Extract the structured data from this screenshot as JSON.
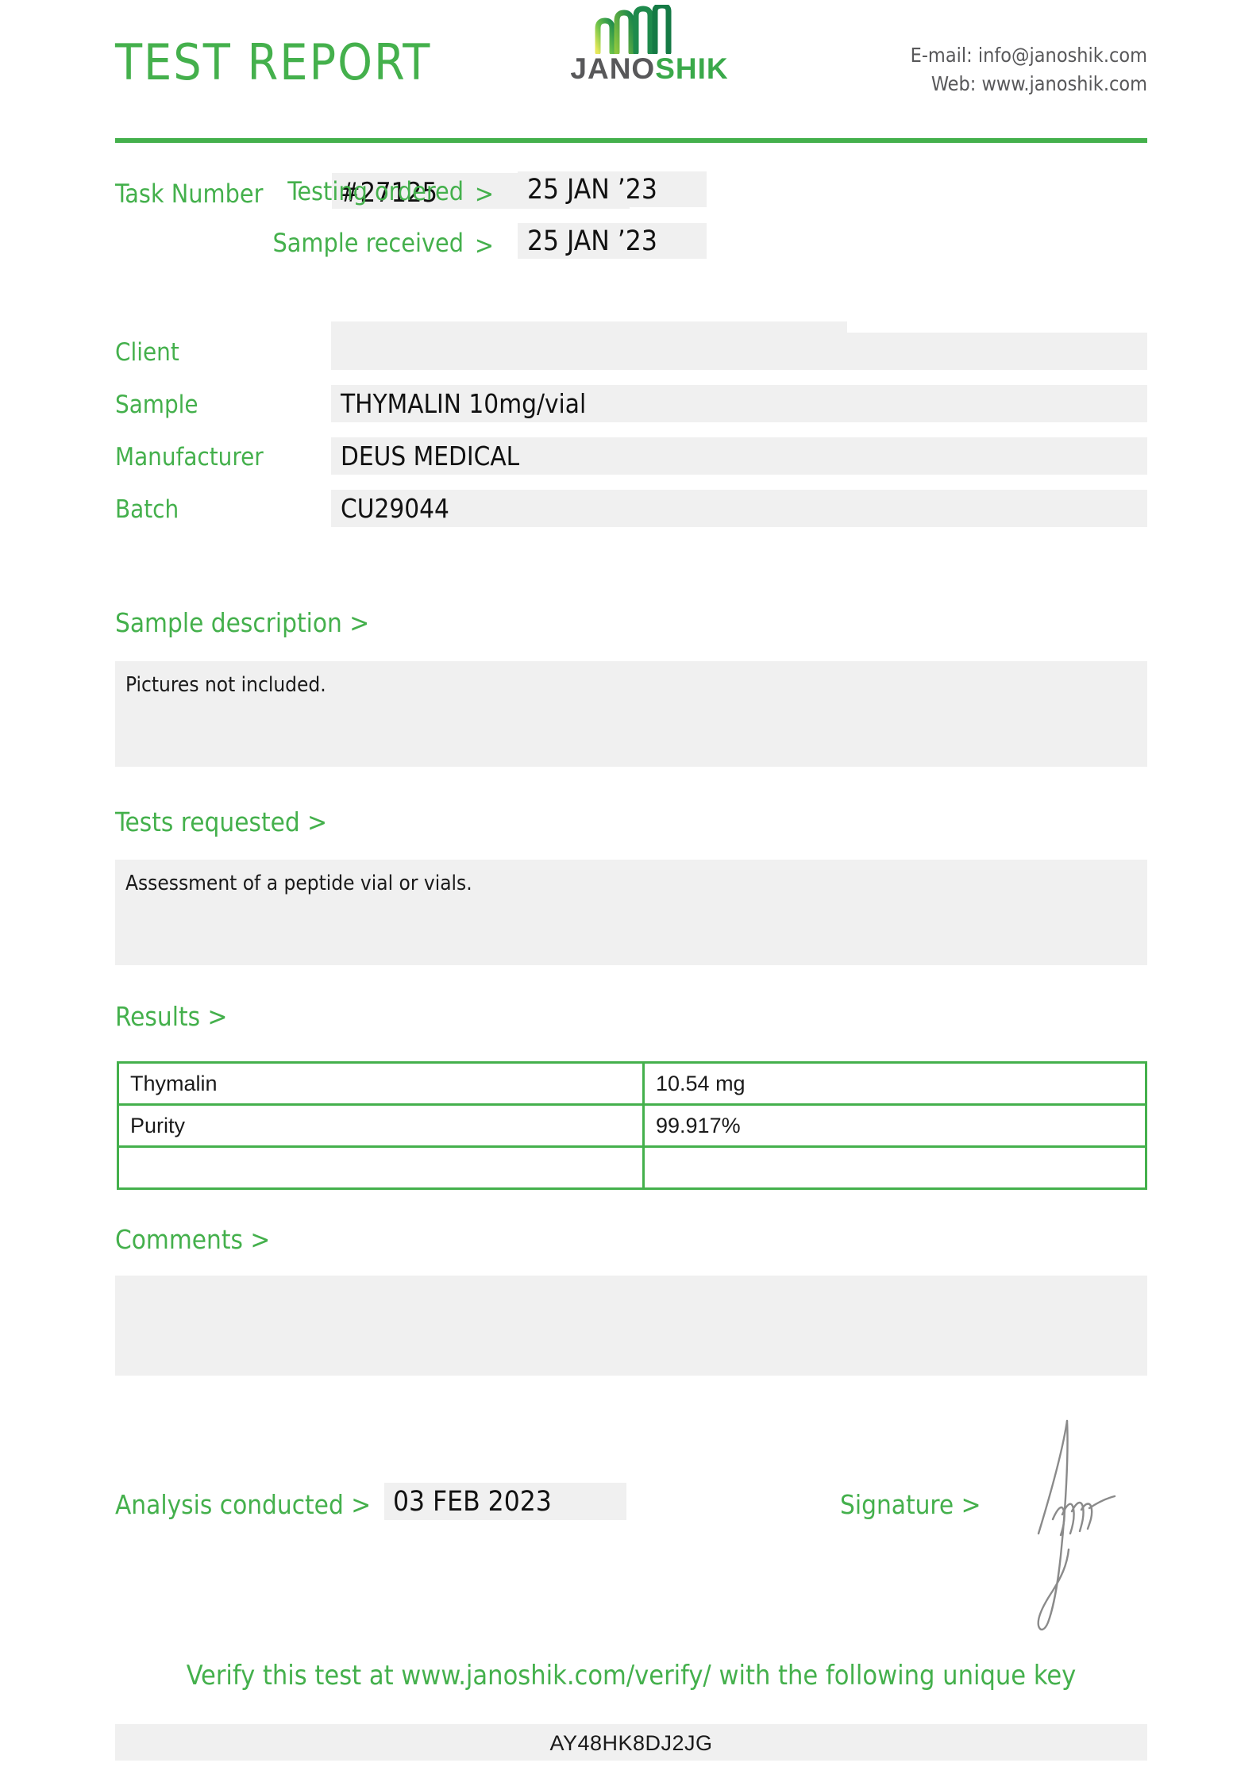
{
  "header": {
    "title": "TEST REPORT",
    "brand_dark": "JANO",
    "brand_green": "SHIK",
    "email_line": "E-mail: info@janoshik.com",
    "web_line": "Web: www.janoshik.com"
  },
  "task": {
    "label": "Task Number",
    "number": "#27125"
  },
  "dates": {
    "testing_ordered_label": "Testing ordered",
    "testing_ordered_value": "25 JAN ’23",
    "sample_received_label": "Sample received",
    "sample_received_value": "25 JAN ’23",
    "separator": ">"
  },
  "info": {
    "client_label": "Client",
    "client_value": "",
    "sample_label": "Sample",
    "sample_value": "THYMALIN 10mg/vial",
    "manufacturer_label": "Manufacturer",
    "manufacturer_value": "DEUS MEDICAL",
    "batch_label": "Batch",
    "batch_value": "CU29044"
  },
  "sample_description": {
    "heading": "Sample description >",
    "text": "Pictures not included."
  },
  "tests_requested": {
    "heading": "Tests requested >",
    "text": "Assessment of a peptide vial or vials."
  },
  "results": {
    "heading": "Results >",
    "rows": [
      {
        "name": "Thymalin",
        "value": "10.54 mg"
      },
      {
        "name": "Purity",
        "value": "99.917%"
      },
      {
        "name": "",
        "value": ""
      }
    ]
  },
  "comments": {
    "heading": "Comments >",
    "text": ""
  },
  "footer": {
    "analysis_label": "Analysis conducted",
    "analysis_separator": ">",
    "analysis_date": "03 FEB 2023",
    "signature_label": "Signature",
    "signature_separator": ">",
    "verify_text": "Verify this test at www.janoshik.com/verify/ with the following unique key",
    "unique_key": "AY48HK8DJ2JG"
  },
  "colors": {
    "accent_green": "#44b04c",
    "brand_dark": "#58585a",
    "field_fill": "#f0f0f0"
  }
}
